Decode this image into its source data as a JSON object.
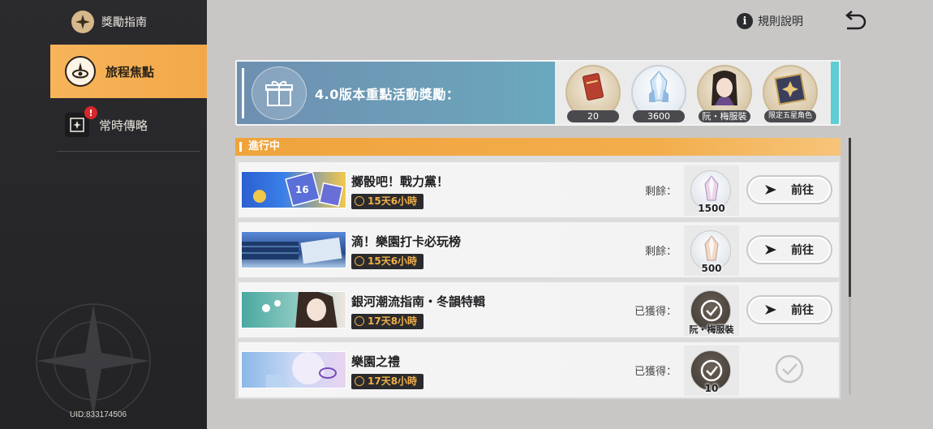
{
  "sidebar": {
    "header_label": "獎勵指南",
    "items": [
      {
        "label": "旅程焦點",
        "active": true,
        "icon": "compass-eye-icon"
      },
      {
        "label": "常時傳略",
        "active": false,
        "icon": "star-card-icon",
        "alert": "!"
      }
    ],
    "uid": "UID:833174506"
  },
  "topbar": {
    "rules_label": "規則說明",
    "rules_icon": "i"
  },
  "banner": {
    "title": "4.0版本重點活動獎勵：",
    "rewards": [
      {
        "label": "20",
        "icon": "pass-ticket-icon"
      },
      {
        "label": "3600",
        "icon": "crystal-icon"
      },
      {
        "label": "阮・梅服裝",
        "icon": "outfit-icon"
      },
      {
        "label": "限定五星角色",
        "icon": "character-box-icon"
      }
    ]
  },
  "progress": {
    "header": "進行中",
    "rows": [
      {
        "name": "擲骰吧！戰力黨！",
        "timer": "15天6小時",
        "status": "剩餘：",
        "reward_count": "1500",
        "action": "前往",
        "claimed": false
      },
      {
        "name": "滴！樂園打卡必玩榜",
        "timer": "15天6小時",
        "status": "剩餘：",
        "reward_count": "500",
        "action": "前往",
        "claimed": false
      },
      {
        "name": "銀河潮流指南・冬韻特輯",
        "timer": "17天8小時",
        "status": "已獲得：",
        "reward_count": "阮・梅服裝",
        "action": "前往",
        "claimed": true
      },
      {
        "name": "樂園之禮",
        "timer": "17天8小時",
        "status": "已獲得：",
        "reward_count": "10",
        "action": "",
        "claimed": true
      }
    ]
  },
  "colors": {
    "accent": "#f2a84a",
    "sidebar_bg": "#2b2b2e",
    "timer_text": "#f1b048",
    "banner_teal": "#60b6c6"
  }
}
